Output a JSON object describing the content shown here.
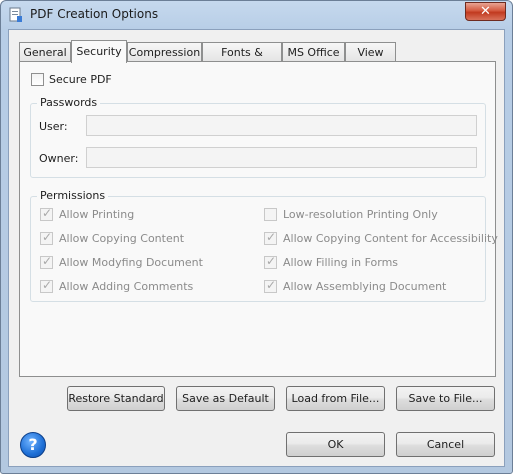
{
  "window": {
    "title": "PDF Creation Options",
    "close_glyph": "✕"
  },
  "tabs": [
    {
      "label": "General"
    },
    {
      "label": "Security"
    },
    {
      "label": "Compression"
    },
    {
      "label": "Fonts & Colors"
    },
    {
      "label": "MS Office"
    },
    {
      "label": "View"
    }
  ],
  "active_tab": "Security",
  "security": {
    "secure_pdf_label": "Secure PDF",
    "secure_pdf_checked": false,
    "passwords": {
      "title": "Passwords",
      "user_label": "User:",
      "user_value": "",
      "owner_label": "Owner:",
      "owner_value": ""
    },
    "permissions": {
      "title": "Permissions",
      "items": [
        {
          "label": "Allow Printing",
          "checked": true
        },
        {
          "label": "Allow Copying Content",
          "checked": true
        },
        {
          "label": "Allow Modyfing Document",
          "checked": true
        },
        {
          "label": "Allow Adding Comments",
          "checked": true
        },
        {
          "label": "Low-resolution Printing Only",
          "checked": false
        },
        {
          "label": "Allow Copying Content for Accessibility",
          "checked": true
        },
        {
          "label": "Allow Filling in Forms",
          "checked": true
        },
        {
          "label": "Allow Assemblying Document",
          "checked": true
        }
      ]
    }
  },
  "buttons": {
    "restore_standard": "Restore Standard",
    "save_as_default": "Save as Default",
    "load_from_file": "Load from File...",
    "save_to_file": "Save to File...",
    "ok": "OK",
    "cancel": "Cancel"
  },
  "help": {
    "glyph": "?"
  },
  "icons": {
    "app": "pdf-creator-icon",
    "help": "help-icon",
    "close": "close-icon"
  }
}
